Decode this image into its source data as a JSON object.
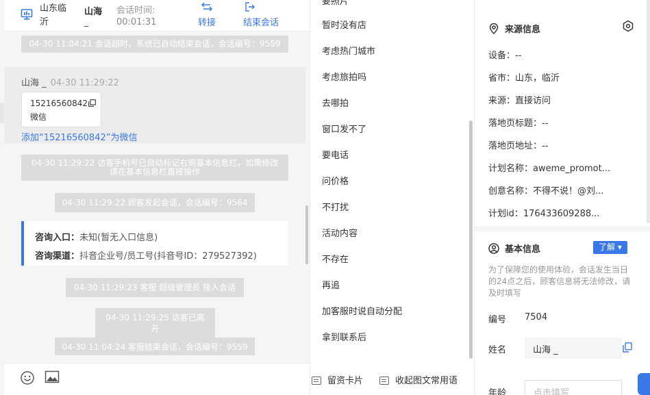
{
  "header": {
    "location": "山东临沂",
    "visitor_name": "山海",
    "visitor_name_suffix": "_",
    "session_time_label": "会话时间:",
    "session_time": "00:01:31",
    "transfer_label": "转接",
    "end_session_label": "结束会话"
  },
  "chat": {
    "messages": {
      "timeout": "04-30 11:04:21 会话超时，系统已自动结束会话，会话编号：9559",
      "sender_name": "山海 _",
      "sender_time": "04-30 11:29:22",
      "phone_number": "15216560842",
      "phone_app": "微信",
      "add_wechat_link": "添加“15216560842”为微信",
      "auto_mark": "04-30 11:29:22 访客手机号已自动标记右侧基本信息栏，如需修改请在基本信息栏直接操作",
      "start_session": "04-30 11:29:22 顾客发起会话，会话编号：9564",
      "consult_entry_label": "咨询入口：",
      "consult_entry_value": "未知(暂无入口信息)",
      "consult_channel_label": "咨询渠道：",
      "consult_channel_value": "抖音企业号/员工号(抖音号ID：279527392)",
      "agent_join": "04-30 11:29:23 客服 超级管理员 接入会话",
      "visitor_left": "04-30 11:29:25 访客已离开",
      "agent_end": "04-30 11:04:24 客服结束会话，会话编号：9559"
    },
    "toolbar": {
      "emoji_icon": "smile-icon",
      "image_icon": "image-icon"
    }
  },
  "quick_replies": {
    "clipped_top": "要照片",
    "items": [
      "暂时没有店",
      "考虑热门城市",
      "考虑旅拍吗",
      "去哪拍",
      "窗口发不了",
      "要电话",
      "问价格",
      "不打扰",
      "活动内容",
      "不存在",
      "再追",
      "加客服时说自动分配",
      "拿到联系后"
    ],
    "footer": {
      "card_label": "留资卡片",
      "collapse_label": "收起图文常用语"
    }
  },
  "info": {
    "source": {
      "title": "来源信息",
      "device": "设备：--",
      "province_city": "省市：山东，临沂",
      "origin": "来源：直接访问",
      "landing_title": "落地页标题：--",
      "landing_url": "落地页地址：--",
      "plan_name": "计划名称：aweme_promot...",
      "creative_name": "创意名称：不得不说！@刘...",
      "plan_id": "计划id：176433609288..."
    },
    "basic": {
      "title": "基本信息",
      "learn_button": "了解 ▾",
      "notice": "为了保障您的使用体验，会话发生当日的24点之后，顾客信息将无法修改，请及时填写",
      "id_label": "编号",
      "id_value": "7504",
      "name_label": "姓名",
      "name_value": "山海 _",
      "age_label": "年龄",
      "age_placeholder": "点击填写"
    }
  },
  "colors": {
    "accent": "#3a78e7",
    "system_bubble": "#dcdcdc",
    "chat_bg": "#f5f5f5"
  }
}
